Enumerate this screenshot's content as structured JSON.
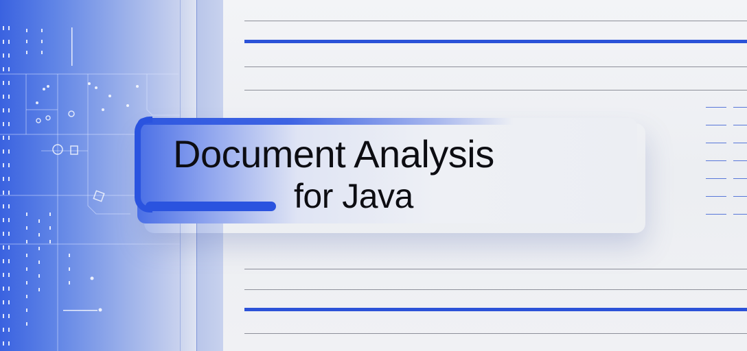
{
  "title": {
    "line1": "Document Analysis",
    "line2": "for Java"
  },
  "colors": {
    "accent_blue": "#2a53df",
    "panel_blue": "#3a62e0",
    "background": "#eef0f4",
    "text": "#0d0d12"
  }
}
